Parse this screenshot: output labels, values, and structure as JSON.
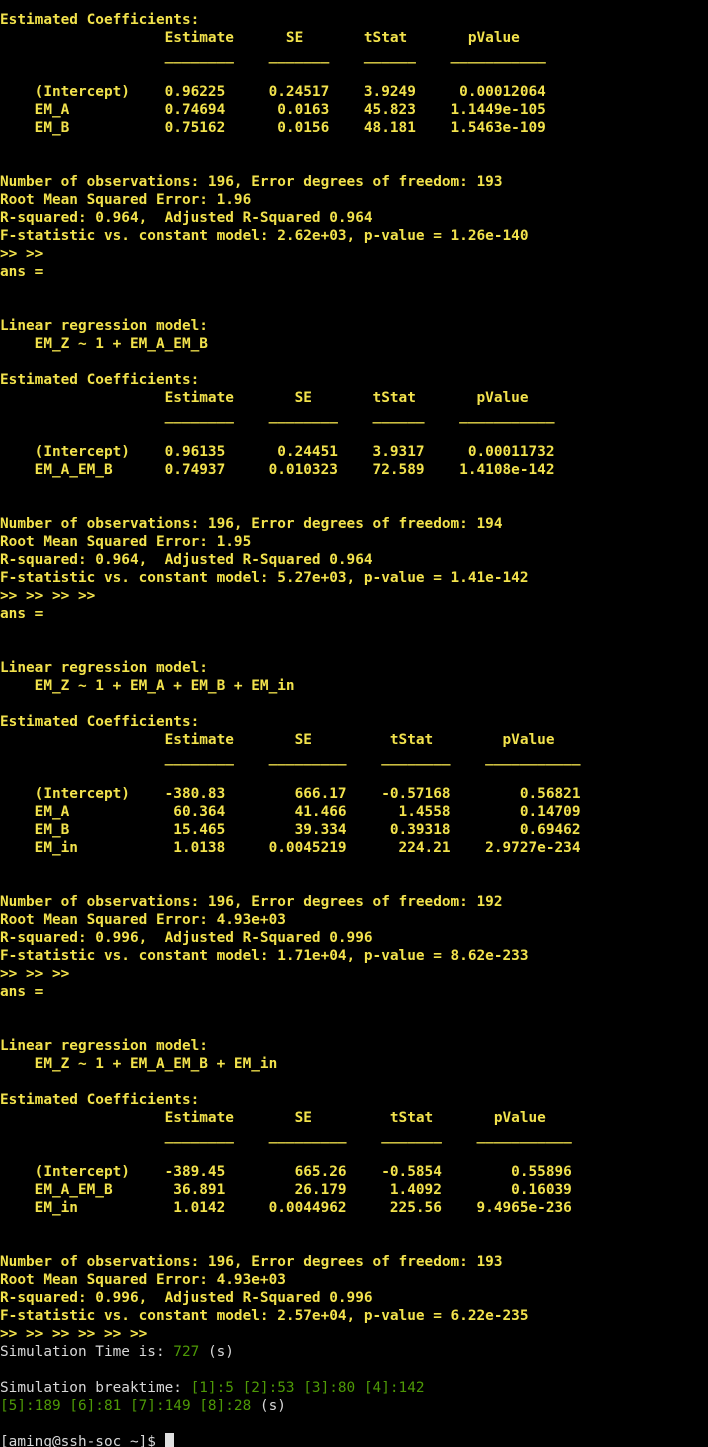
{
  "lines": [
    {
      "t": "Estimated Coefficients:",
      "c": "yellow"
    },
    {
      "t": "                   Estimate      SE       tStat       pValue   ",
      "c": "yellow"
    },
    {
      "t": "                   ________    _______    ______    ___________",
      "c": "yellow"
    },
    {
      "t": "",
      "c": "yellow"
    },
    {
      "t": "    (Intercept)    0.96225     0.24517    3.9249     0.00012064",
      "c": "yellow"
    },
    {
      "t": "    EM_A           0.74694      0.0163    45.823    1.1449e-105",
      "c": "yellow"
    },
    {
      "t": "    EM_B           0.75162      0.0156    48.181    1.5463e-109",
      "c": "yellow"
    },
    {
      "t": "",
      "c": "yellow"
    },
    {
      "t": "",
      "c": "yellow"
    },
    {
      "t": "Number of observations: 196, Error degrees of freedom: 193",
      "c": "yellow"
    },
    {
      "t": "Root Mean Squared Error: 1.96",
      "c": "yellow"
    },
    {
      "t": "R-squared: 0.964,  Adjusted R-Squared 0.964",
      "c": "yellow"
    },
    {
      "t": "F-statistic vs. constant model: 2.62e+03, p-value = 1.26e-140",
      "c": "yellow"
    },
    {
      "t": ">> >>",
      "c": "yellow"
    },
    {
      "t": "ans =",
      "c": "yellow"
    },
    {
      "t": "",
      "c": "yellow"
    },
    {
      "t": "",
      "c": "yellow"
    },
    {
      "t": "Linear regression model:",
      "c": "yellow"
    },
    {
      "t": "    EM_Z ~ 1 + EM_A_EM_B",
      "c": "yellow"
    },
    {
      "t": "",
      "c": "yellow"
    },
    {
      "t": "Estimated Coefficients:",
      "c": "yellow"
    },
    {
      "t": "                   Estimate       SE       tStat       pValue   ",
      "c": "yellow"
    },
    {
      "t": "                   ________    ________    ______    ___________",
      "c": "yellow"
    },
    {
      "t": "",
      "c": "yellow"
    },
    {
      "t": "    (Intercept)    0.96135      0.24451    3.9317     0.00011732",
      "c": "yellow"
    },
    {
      "t": "    EM_A_EM_B      0.74937     0.010323    72.589    1.4108e-142",
      "c": "yellow"
    },
    {
      "t": "",
      "c": "yellow"
    },
    {
      "t": "",
      "c": "yellow"
    },
    {
      "t": "Number of observations: 196, Error degrees of freedom: 194",
      "c": "yellow"
    },
    {
      "t": "Root Mean Squared Error: 1.95",
      "c": "yellow"
    },
    {
      "t": "R-squared: 0.964,  Adjusted R-Squared 0.964",
      "c": "yellow"
    },
    {
      "t": "F-statistic vs. constant model: 5.27e+03, p-value = 1.41e-142",
      "c": "yellow"
    },
    {
      "t": ">> >> >> >>",
      "c": "yellow"
    },
    {
      "t": "ans =",
      "c": "yellow"
    },
    {
      "t": "",
      "c": "yellow"
    },
    {
      "t": "",
      "c": "yellow"
    },
    {
      "t": "Linear regression model:",
      "c": "yellow"
    },
    {
      "t": "    EM_Z ~ 1 + EM_A + EM_B + EM_in",
      "c": "yellow"
    },
    {
      "t": "",
      "c": "yellow"
    },
    {
      "t": "Estimated Coefficients:",
      "c": "yellow"
    },
    {
      "t": "                   Estimate       SE         tStat        pValue   ",
      "c": "yellow"
    },
    {
      "t": "                   ________    _________    ________    ___________",
      "c": "yellow"
    },
    {
      "t": "",
      "c": "yellow"
    },
    {
      "t": "    (Intercept)    -380.83        666.17    -0.57168        0.56821",
      "c": "yellow"
    },
    {
      "t": "    EM_A            60.364        41.466      1.4558        0.14709",
      "c": "yellow"
    },
    {
      "t": "    EM_B            15.465        39.334     0.39318        0.69462",
      "c": "yellow"
    },
    {
      "t": "    EM_in           1.0138     0.0045219      224.21    2.9727e-234",
      "c": "yellow"
    },
    {
      "t": "",
      "c": "yellow"
    },
    {
      "t": "",
      "c": "yellow"
    },
    {
      "t": "Number of observations: 196, Error degrees of freedom: 192",
      "c": "yellow"
    },
    {
      "t": "Root Mean Squared Error: 4.93e+03",
      "c": "yellow"
    },
    {
      "t": "R-squared: 0.996,  Adjusted R-Squared 0.996",
      "c": "yellow"
    },
    {
      "t": "F-statistic vs. constant model: 1.71e+04, p-value = 8.62e-233",
      "c": "yellow"
    },
    {
      "t": ">> >> >>",
      "c": "yellow"
    },
    {
      "t": "ans =",
      "c": "yellow"
    },
    {
      "t": "",
      "c": "yellow"
    },
    {
      "t": "",
      "c": "yellow"
    },
    {
      "t": "Linear regression model:",
      "c": "yellow"
    },
    {
      "t": "    EM_Z ~ 1 + EM_A_EM_B + EM_in",
      "c": "yellow"
    },
    {
      "t": "",
      "c": "yellow"
    },
    {
      "t": "Estimated Coefficients:",
      "c": "yellow"
    },
    {
      "t": "                   Estimate       SE         tStat       pValue   ",
      "c": "yellow"
    },
    {
      "t": "                   ________    _________    _______    ___________",
      "c": "yellow"
    },
    {
      "t": "",
      "c": "yellow"
    },
    {
      "t": "    (Intercept)    -389.45        665.26    -0.5854        0.55896",
      "c": "yellow"
    },
    {
      "t": "    EM_A_EM_B       36.891        26.179     1.4092        0.16039",
      "c": "yellow"
    },
    {
      "t": "    EM_in           1.0142     0.0044962     225.56    9.4965e-236",
      "c": "yellow"
    },
    {
      "t": "",
      "c": "yellow"
    },
    {
      "t": "",
      "c": "yellow"
    },
    {
      "t": "Number of observations: 196, Error degrees of freedom: 193",
      "c": "yellow"
    },
    {
      "t": "Root Mean Squared Error: 4.93e+03",
      "c": "yellow"
    },
    {
      "t": "R-squared: 0.996,  Adjusted R-Squared 0.996",
      "c": "yellow"
    },
    {
      "t": "F-statistic vs. constant model: 2.57e+04, p-value = 6.22e-235",
      "c": "yellow"
    },
    {
      "t": ">> >> >> >> >> >>",
      "c": "yellow"
    }
  ],
  "simulation": {
    "time_label": "Simulation Time is: ",
    "time_value": "727",
    "time_unit": " (s)",
    "breaktime_label": "Simulation breaktime: ",
    "breaktime_line1": "[1]:5 [2]:53 [3]:80 [4]:142",
    "breaktime_line2": "[5]:189 [6]:81 [7]:149 [8]:28",
    "breaktime_unit": " (s)"
  },
  "prompt": {
    "text": "[aming@ssh-soc ~]$ "
  },
  "colors": {
    "background": "#000000",
    "output_yellow": "#f2e24c",
    "normal_text": "#d8d8d8",
    "value_green": "#4e9a06"
  }
}
